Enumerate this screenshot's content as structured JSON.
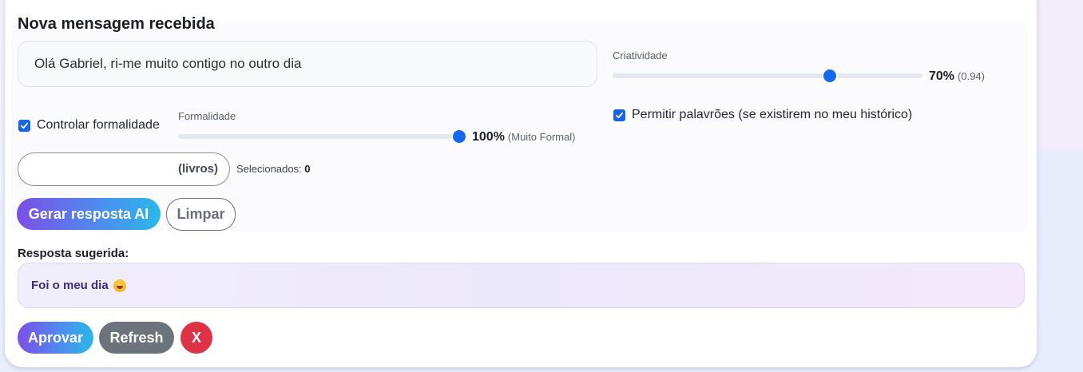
{
  "title": "Nova mensagem recebida",
  "message_input": {
    "value": "Olá Gabriel, ri-me muito contigo no outro dia"
  },
  "creativity": {
    "label": "Criatividade",
    "percent_text": "70%",
    "sub_text": "(0.94)",
    "level": 0.7
  },
  "formality_control": {
    "label": "Controlar formalidade",
    "checked": true
  },
  "formality": {
    "label": "Formalidade",
    "percent_text": "100%",
    "sub_text": "(Muito Formal)",
    "level": 1.0
  },
  "profanity": {
    "label": "Permitir palavrões (se existirem no meu histórico)",
    "checked": true
  },
  "books": {
    "label": "(livros)",
    "selected_label": "Selecionados:",
    "selected_count": "0"
  },
  "actions": {
    "generate": "Gerar resposta AI",
    "clear": "Limpar"
  },
  "response": {
    "label": "Resposta sugerida:",
    "text": "Foi o meu dia",
    "emoji_icon": "rolling-on-floor-laughing-emoji"
  },
  "response_actions": {
    "approve": "Aprovar",
    "refresh": "Refresh",
    "close": "X"
  },
  "colors": {
    "accent": "#1668f0",
    "gradient_start": "#7b4fe6",
    "gradient_end": "#2ab8e8",
    "danger": "#dc3446"
  }
}
